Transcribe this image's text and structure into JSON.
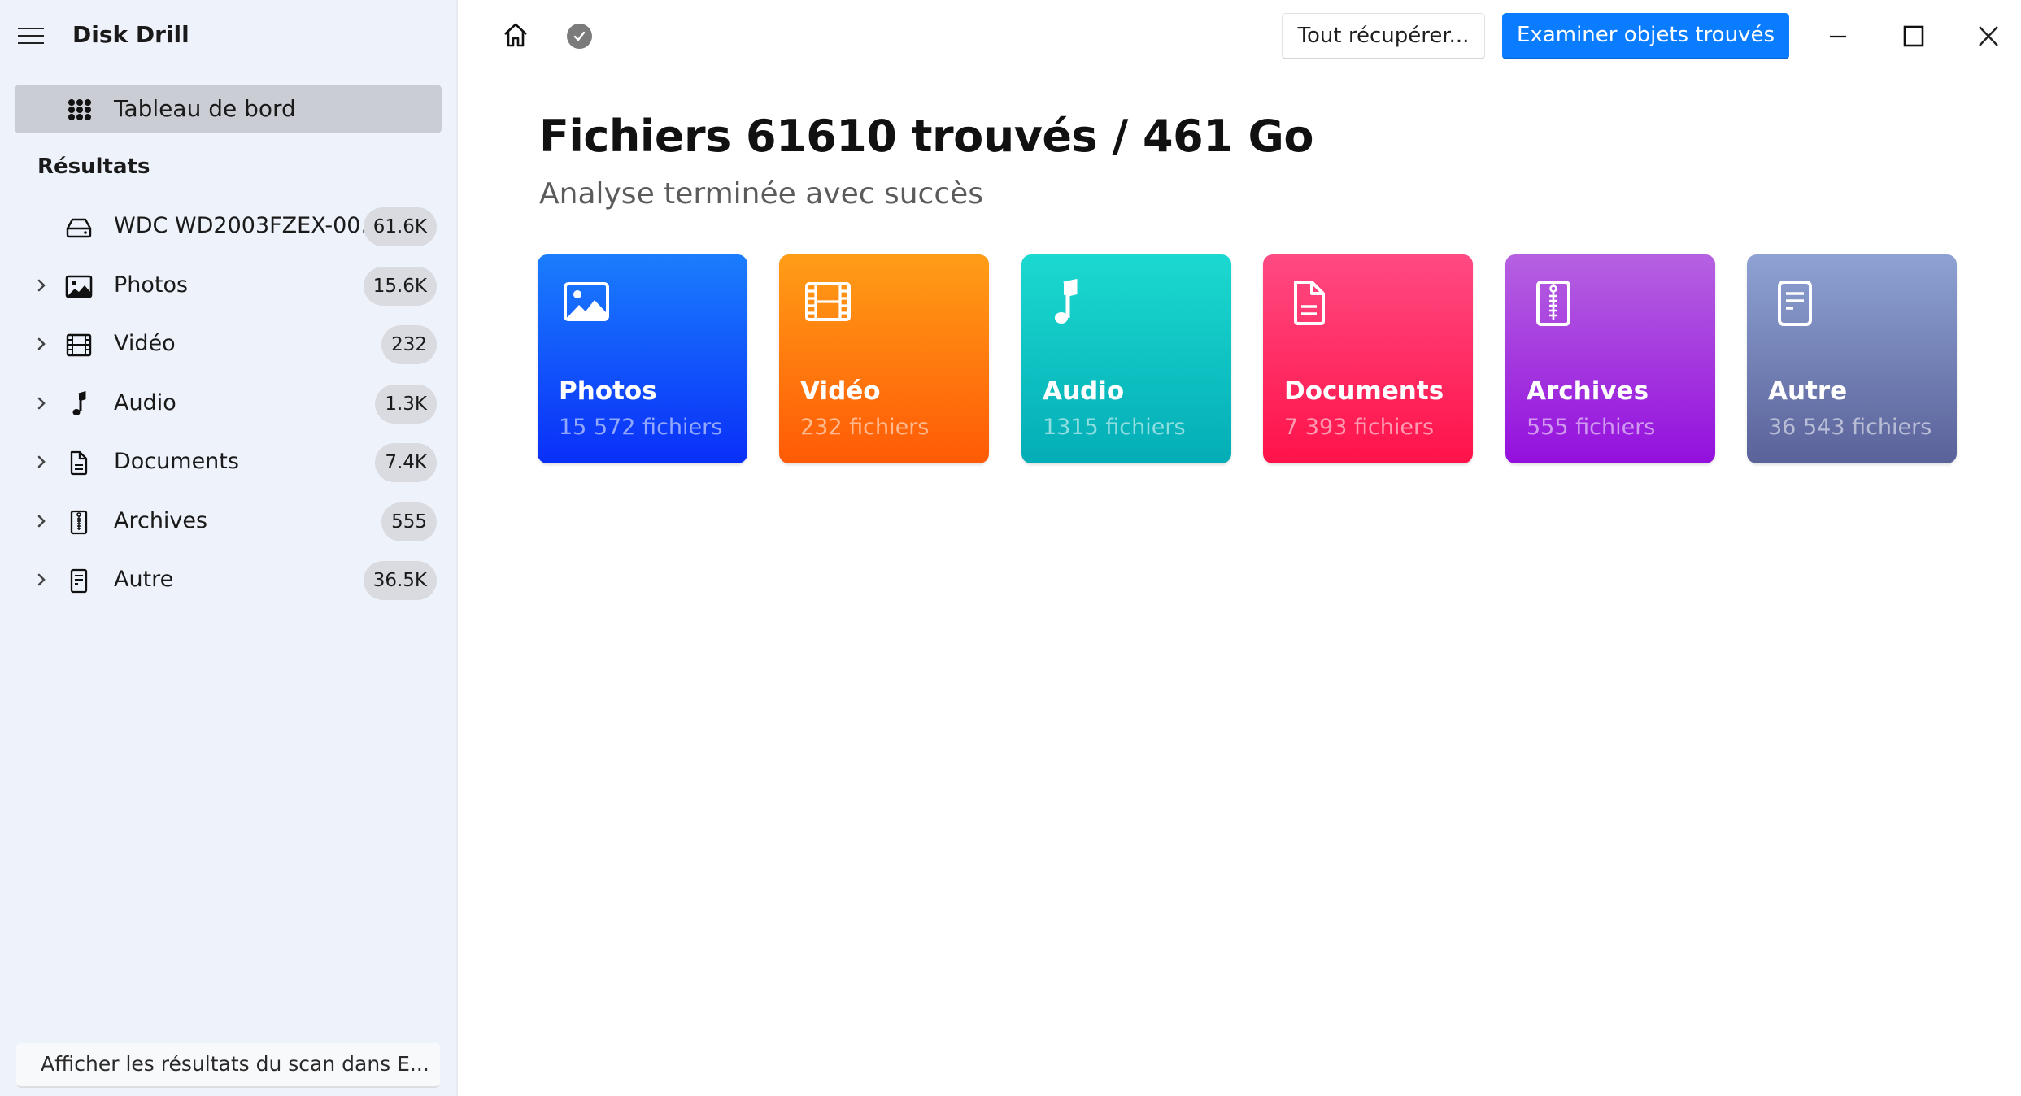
{
  "app": {
    "title": "Disk Drill",
    "menu_icon": "hamburger-icon"
  },
  "sidebar": {
    "dashboard": {
      "label": "Tableau de bord",
      "icon": "grid-icon",
      "selected": true
    },
    "section_label": "Résultats",
    "results": [
      {
        "label": "WDC WD2003FZEX-00...",
        "count": "61.6K",
        "icon": "hard-drive-icon",
        "expandable": false
      },
      {
        "label": "Photos",
        "count": "15.6K",
        "icon": "image-icon",
        "expandable": true
      },
      {
        "label": "Vidéo",
        "count": "232",
        "icon": "film-icon",
        "expandable": true
      },
      {
        "label": "Audio",
        "count": "1.3K",
        "icon": "music-note-icon",
        "expandable": true
      },
      {
        "label": "Documents",
        "count": "7.4K",
        "icon": "document-icon",
        "expandable": true
      },
      {
        "label": "Archives",
        "count": "555",
        "icon": "archive-zip-icon",
        "expandable": true
      },
      {
        "label": "Autre",
        "count": "36.5K",
        "icon": "other-file-icon",
        "expandable": true
      }
    ],
    "scan_button": "Afficher les résultats du scan dans E..."
  },
  "toolbar": {
    "home_icon": "home-icon",
    "status_icon": "check-circle-icon",
    "recover_all": "Tout récupérer...",
    "review_found": "Examiner objets trouvés"
  },
  "window_controls": {
    "minimize": "minimize-icon",
    "maximize": "maximize-icon",
    "close": "close-icon"
  },
  "main": {
    "title": "Fichiers 61610 trouvés / 461 Go",
    "subtitle": "Analyse terminée avec succès",
    "cards": [
      {
        "name": "Photos",
        "count": "15 572 fichiers",
        "icon": "image-icon",
        "color_top": "#1a7dfd",
        "color_bottom": "#0a2ff8"
      },
      {
        "name": "Vidéo",
        "count": "232 fichiers",
        "icon": "film-icon",
        "color_top": "#ff9d17",
        "color_bottom": "#ff5a06"
      },
      {
        "name": "Audio",
        "count": "1315 fichiers",
        "icon": "music-note-icon",
        "color_top": "#1bd9d0",
        "color_bottom": "#04adb6"
      },
      {
        "name": "Documents",
        "count": "7 393 fichiers",
        "icon": "document-icon",
        "color_top": "#ff4a82",
        "color_bottom": "#ff1249"
      },
      {
        "name": "Archives",
        "count": "555 fichiers",
        "icon": "archive-zip-icon",
        "color_top": "#b561e1",
        "color_bottom": "#9410dd"
      },
      {
        "name": "Autre",
        "count": "36 543 fichiers",
        "icon": "other-file-icon",
        "color_top": "#8ea2d3",
        "color_bottom": "#5a6299"
      }
    ]
  },
  "colors": {
    "accent": "#0a7cff",
    "sidebar_bg": "#eef2fa",
    "selected_bg": "#cacdd3",
    "badge_bg": "#d9dbe0"
  }
}
